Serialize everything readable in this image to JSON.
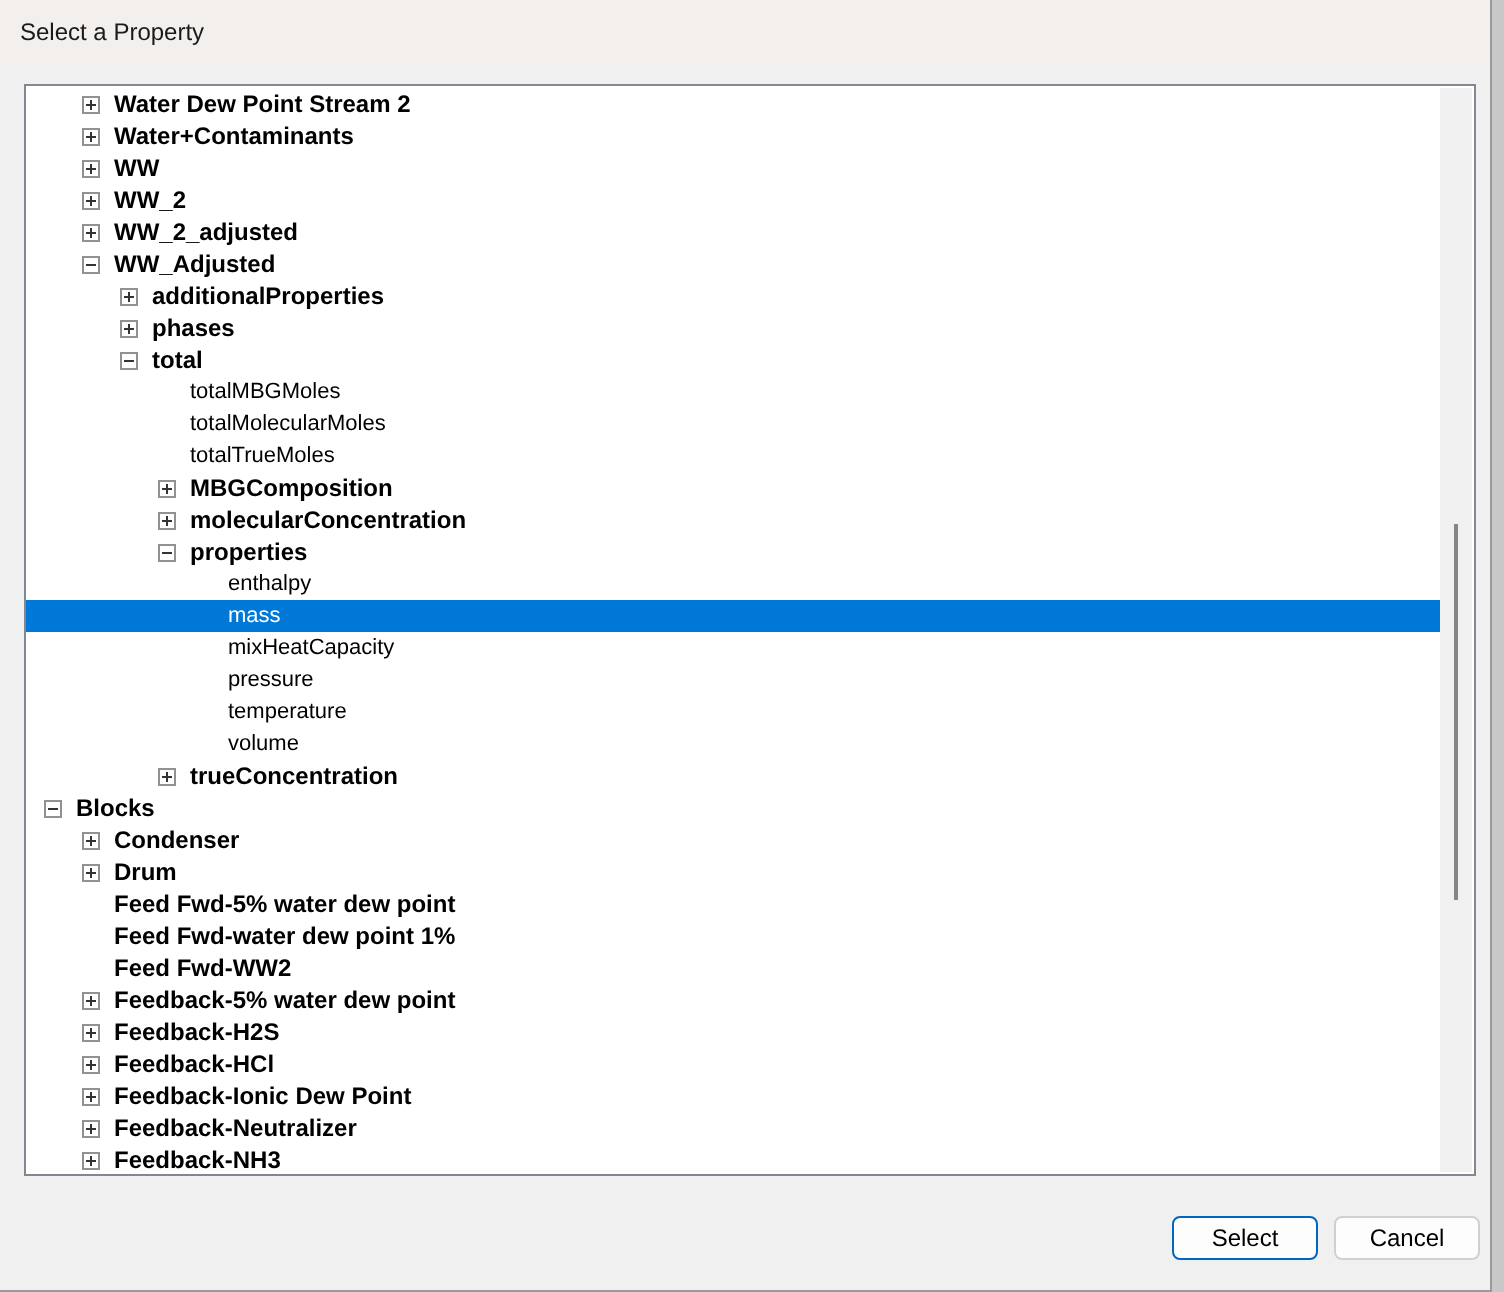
{
  "window": {
    "title": "Select a Property"
  },
  "tree": [
    {
      "children": [
        {
          "label": "Water Dew Point Stream 2",
          "kind": "group",
          "expanded": false,
          "selected": false
        },
        {
          "label": "Water+Contaminants",
          "kind": "group",
          "expanded": false,
          "selected": false
        },
        {
          "label": "WW",
          "kind": "group",
          "expanded": false,
          "selected": false
        },
        {
          "label": "WW_2",
          "kind": "group",
          "expanded": false,
          "selected": false
        },
        {
          "label": "WW_2_adjusted",
          "kind": "group",
          "expanded": false,
          "selected": false
        },
        {
          "label": "WW_Adjusted",
          "kind": "group",
          "expanded": true,
          "selected": false,
          "children": [
            {
              "label": "additionalProperties",
              "kind": "group",
              "expanded": false,
              "selected": false
            },
            {
              "label": "phases",
              "kind": "group",
              "expanded": false,
              "selected": false
            },
            {
              "label": "total",
              "kind": "group",
              "expanded": true,
              "selected": false,
              "children": [
                {
                  "label": "totalMBGMoles",
                  "kind": "leaf",
                  "selected": false
                },
                {
                  "label": "totalMolecularMoles",
                  "kind": "leaf",
                  "selected": false
                },
                {
                  "label": "totalTrueMoles",
                  "kind": "leaf",
                  "selected": false
                },
                {
                  "label": "MBGComposition",
                  "kind": "group",
                  "expanded": false,
                  "selected": false
                },
                {
                  "label": "molecularConcentration",
                  "kind": "group",
                  "expanded": false,
                  "selected": false
                },
                {
                  "label": "properties",
                  "kind": "group",
                  "expanded": true,
                  "selected": false,
                  "children": [
                    {
                      "label": "enthalpy",
                      "kind": "leaf",
                      "selected": false
                    },
                    {
                      "label": "mass",
                      "kind": "leaf",
                      "selected": true
                    },
                    {
                      "label": "mixHeatCapacity",
                      "kind": "leaf",
                      "selected": false
                    },
                    {
                      "label": "pressure",
                      "kind": "leaf",
                      "selected": false
                    },
                    {
                      "label": "temperature",
                      "kind": "leaf",
                      "selected": false
                    },
                    {
                      "label": "volume",
                      "kind": "leaf",
                      "selected": false
                    }
                  ]
                },
                {
                  "label": "trueConcentration",
                  "kind": "group",
                  "expanded": false,
                  "selected": false
                }
              ]
            }
          ]
        }
      ]
    },
    {
      "label": "Blocks",
      "kind": "group",
      "expanded": true,
      "selected": false,
      "children": [
        {
          "label": "Condenser",
          "kind": "group",
          "expanded": false,
          "selected": false
        },
        {
          "label": "Drum",
          "kind": "group",
          "expanded": false,
          "selected": false
        },
        {
          "label": "Feed Fwd-5% water dew point",
          "kind": "group",
          "selected": false
        },
        {
          "label": "Feed Fwd-water dew point 1%",
          "kind": "group",
          "selected": false
        },
        {
          "label": "Feed Fwd-WW2",
          "kind": "group",
          "selected": false
        },
        {
          "label": "Feedback-5% water dew point",
          "kind": "group",
          "expanded": false,
          "selected": false
        },
        {
          "label": "Feedback-H2S",
          "kind": "group",
          "expanded": false,
          "selected": false
        },
        {
          "label": "Feedback-HCl",
          "kind": "group",
          "expanded": false,
          "selected": false
        },
        {
          "label": "Feedback-Ionic Dew Point",
          "kind": "group",
          "expanded": false,
          "selected": false
        },
        {
          "label": "Feedback-Neutralizer",
          "kind": "group",
          "expanded": false,
          "selected": false
        },
        {
          "label": "Feedback-NH3",
          "kind": "group",
          "expanded": false,
          "selected": false
        }
      ]
    }
  ],
  "buttons": [
    {
      "label": "Select",
      "kind": "default"
    },
    {
      "label": "Cancel",
      "kind": "normal"
    }
  ]
}
